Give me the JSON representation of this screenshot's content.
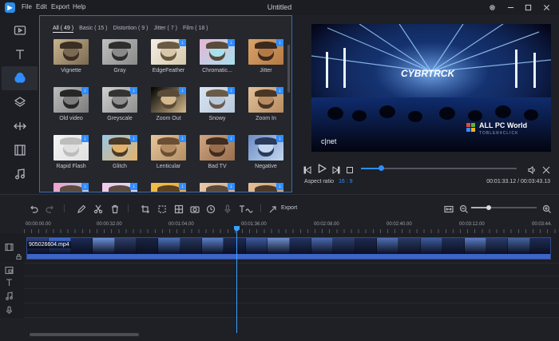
{
  "app": {
    "logo_text": "",
    "title": "Untitled",
    "menu": [
      "File",
      "Edit",
      "Export",
      "Help"
    ]
  },
  "rail": {
    "items": [
      "video-icon",
      "text-icon",
      "filter-icon",
      "overlay-icon",
      "transition-icon",
      "film-icon",
      "music-icon"
    ],
    "active_index": 2
  },
  "filters": {
    "tabs": [
      "All ( 49 )",
      "Basic ( 15 )",
      "Distortion ( 9 )",
      "Jitter ( 7 )",
      "Film ( 18 )"
    ],
    "active_tab": 0,
    "items": [
      {
        "label": "Vignette",
        "download": false
      },
      {
        "label": "Gray",
        "download": false
      },
      {
        "label": "EdgeFeather",
        "download": true
      },
      {
        "label": "Chromatic...",
        "download": true
      },
      {
        "label": "Jitter",
        "download": true
      },
      {
        "label": "Old video",
        "download": true
      },
      {
        "label": "Greyscale",
        "download": true
      },
      {
        "label": "Zoom Out",
        "download": true
      },
      {
        "label": "Snowy",
        "download": true
      },
      {
        "label": "Zoom In",
        "download": true
      },
      {
        "label": "Rapid Flash",
        "download": true
      },
      {
        "label": "Glitch",
        "download": true
      },
      {
        "label": "Lenticular",
        "download": true
      },
      {
        "label": "Bad TV",
        "download": true
      },
      {
        "label": "Negative",
        "download": true
      },
      {
        "label": "",
        "download": true
      },
      {
        "label": "",
        "download": true
      },
      {
        "label": "",
        "download": true
      },
      {
        "label": "",
        "download": true
      },
      {
        "label": "",
        "download": true
      }
    ]
  },
  "preview": {
    "overlay_logo": "CYBRTRCK",
    "channel_logo": "c|net",
    "watermark_title": "ALL PC World",
    "watermark_sub": "TOBLER4CLICK",
    "seek_progress": 0.13,
    "aspect_label": "Aspect ratio",
    "aspect_value": "16 : 9",
    "timecode": "00:01:33.12 / 00:03:43.13"
  },
  "timeline": {
    "export_label": "Export",
    "zoom_level": 0.27,
    "ruler_labels": [
      "00:00:00.00",
      "00:00:32.00",
      "00:01:04.00",
      "00:01:36.00",
      "00:02:08.00",
      "00:02:40.00",
      "00:03:12.00",
      "00:03:44."
    ],
    "clip_name": "905026604.mp4",
    "playhead_time": "00:01:33.12"
  },
  "colors": {
    "accent": "#2f8dff",
    "panel_border": "#3a6cb3",
    "clip": "#1a2a52"
  }
}
